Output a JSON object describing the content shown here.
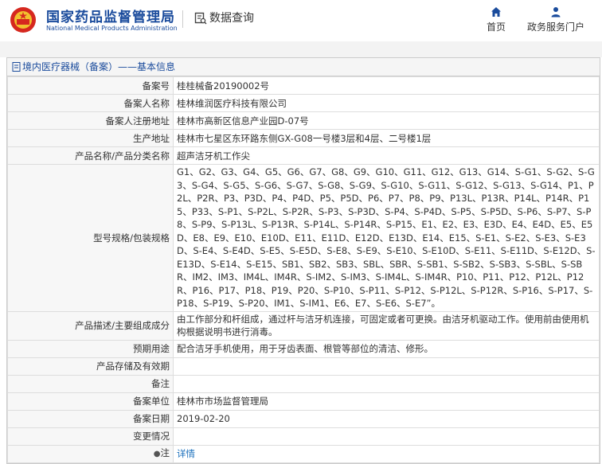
{
  "header": {
    "brand_cn": "国家药品监督管理局",
    "brand_en": "National Medical Products Administration",
    "query": "数据查询",
    "nav_home": "首页",
    "nav_gov": "政务服务门户"
  },
  "panel": {
    "title": "境内医疗器械（备案）——基本信息"
  },
  "rows": [
    {
      "label": "备案号",
      "value": "桂桂械备20190002号"
    },
    {
      "label": "备案人名称",
      "value": "桂林维润医疗科技有限公司"
    },
    {
      "label": "备案人注册地址",
      "value": "桂林市高新区信息产业园D-07号"
    },
    {
      "label": "生产地址",
      "value": "桂林市七星区东环路东侧GX-G08一号楼3层和4层、二号楼1层"
    },
    {
      "label": "产品名称/产品分类名称",
      "value": "超声洁牙机工作尖"
    },
    {
      "label": "型号规格/包装规格",
      "value": "G1、G2、G3、G4、G5、G6、G7、G8、G9、G10、G11、G12、G13、G14、S-G1、S-G2、S-G3、S-G4、S-G5、S-G6、S-G7、S-G8、S-G9、S-G10、S-G11、S-G12、S-G13、S-G14、P1、P2L、P2R、P3、P3D、P4、P4D、P5、P5D、P6、P7、P8、P9、P13L、P13R、P14L、P14R、P15、P33、S-P1、S-P2L、S-P2R、S-P3、S-P3D、S-P4、S-P4D、S-P5、S-P5D、S-P6、S-P7、S-P8、S-P9、S-P13L、S-P13R、S-P14L、S-P14R、S-P15、E1、E2、E3、E3D、E4、E4D、E5、E5D、E8、E9、E10、E10D、E11、E11D、E12D、E13D、E14、E15、S-E1、S-E2、S-E3、S-E3D、S-E4、S-E4D、S-E5、S-E5D、S-E8、S-E9、S-E10、S-E10D、S-E11、S-E11D、S-E12D、S-E13D、S-E14、S-E15、SB1、SB2、SB3、SBL、SBR、S-SB1、S-SB2、S-SB3、S-SBL、S-SBR、IM2、IM3、IM4L、IM4R、S-IM2、S-IM3、S-IM4L、S-IM4R、P10、P11、P12、P12L、P12R、P16、P17、P18、P19、P20、S-P10、S-P11、S-P12、S-P12L、S-P12R、S-P16、S-P17、S-P18、S-P19、S-P20、IM1、S-IM1、E6、E7、S-E6、S-E7”。"
    },
    {
      "label": "产品描述/主要组成成分",
      "value": "由工作部分和杆组成，通过杆与洁牙机连接，可固定或者可更换。由洁牙机驱动工作。使用前由使用机构根据说明书进行消毒。"
    },
    {
      "label": "预期用途",
      "value": "配合洁牙手机使用，用于牙齿表面、根管等部位的清洁、修形。"
    },
    {
      "label": "产品存储及有效期",
      "value": ""
    },
    {
      "label": "备注",
      "value": ""
    },
    {
      "label": "备案单位",
      "value": "桂林市市场监督管理局"
    },
    {
      "label": "备案日期",
      "value": "2019-02-20"
    },
    {
      "label": "变更情况",
      "value": ""
    },
    {
      "label": "注",
      "value": "详情"
    }
  ],
  "colors": {
    "brand": "#1a4b9c",
    "link": "#1a6fbc"
  }
}
